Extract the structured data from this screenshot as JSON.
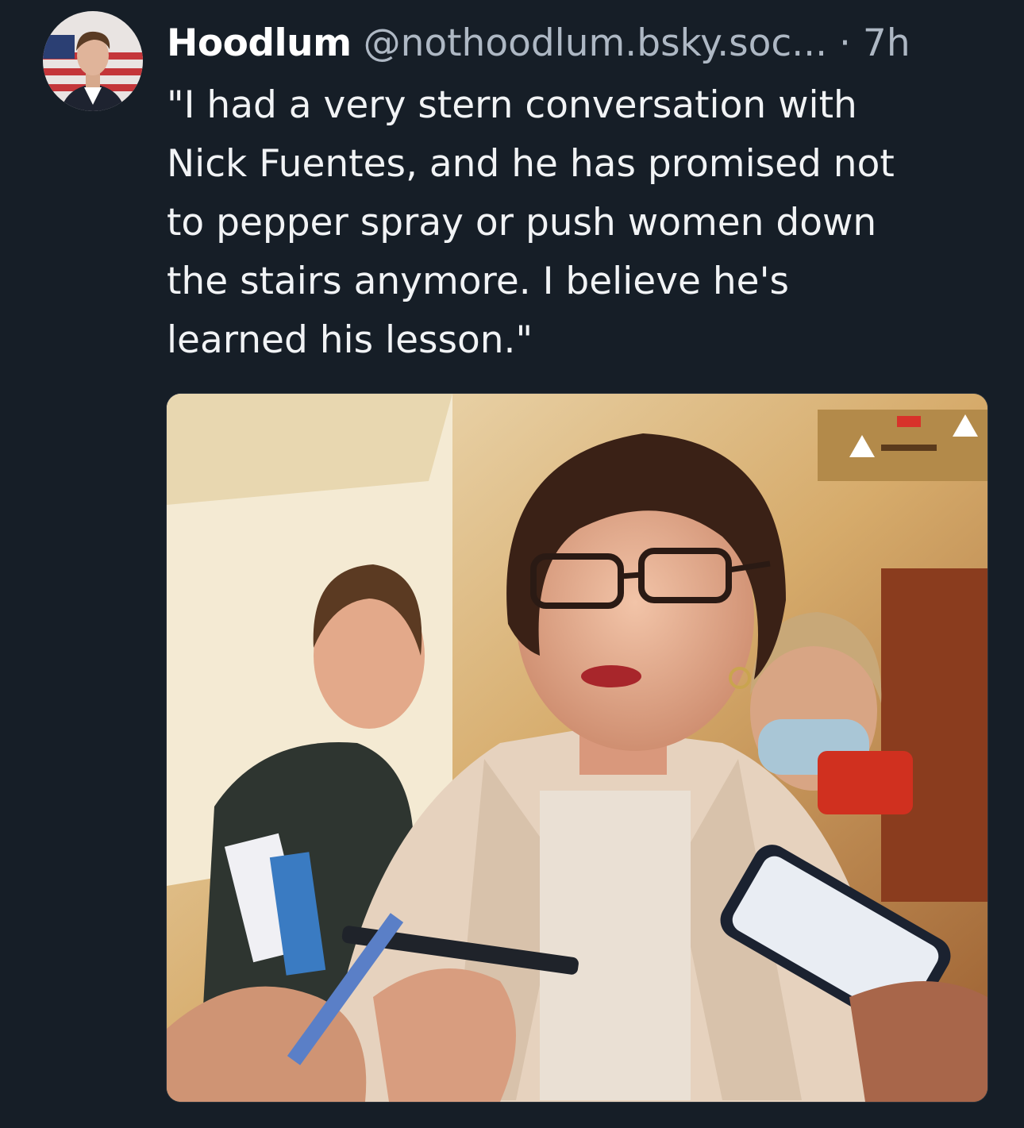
{
  "post": {
    "author": {
      "display_name": "Hoodlum",
      "handle": "@nothoodlum.bsky.soc..."
    },
    "separator": "·",
    "timestamp": "7h",
    "text": "\"I had a very stern conversation with\nNick Fuentes, and he has promised not\nto pepper spray or push women down\nthe stairs anymore. I believe he's\nlearned his lesson.\""
  },
  "colors": {
    "background": "#161e27",
    "text_primary": "#f1f3f5",
    "text_secondary": "#aeb8c4"
  },
  "icons": {
    "avatar": "profile-photo-icon",
    "media": "photo"
  }
}
